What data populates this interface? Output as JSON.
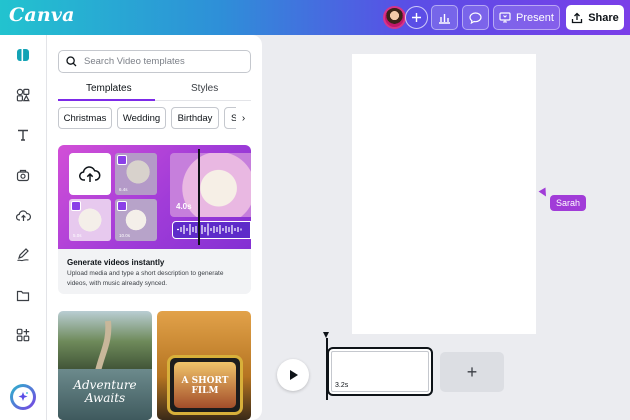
{
  "app": {
    "logo": "Canva"
  },
  "topbar": {
    "present_label": "Present",
    "share_label": "Share"
  },
  "panel": {
    "search_placeholder": "Search Video templates",
    "tabs": [
      {
        "label": "Templates"
      },
      {
        "label": "Styles"
      }
    ],
    "chips": [
      {
        "label": "Christmas"
      },
      {
        "label": "Wedding"
      },
      {
        "label": "Birthday"
      },
      {
        "label": "Sum"
      }
    ],
    "feature_card": {
      "title": "Generate videos instantly",
      "description": "Upload media and type a short description to generate videos, with music already synced.",
      "clip_time": "4.0s",
      "tile_durations": [
        "6.4s",
        "5.0s",
        "10.0s"
      ]
    },
    "templates": [
      {
        "text": "Adventure Awaits"
      },
      {
        "text": "A SHORT FILM"
      }
    ]
  },
  "canvas": {
    "collaborator": "Sarah",
    "accent": "#a13cd8"
  },
  "timeline": {
    "clip_duration": "3.2s",
    "add_label": "+"
  }
}
